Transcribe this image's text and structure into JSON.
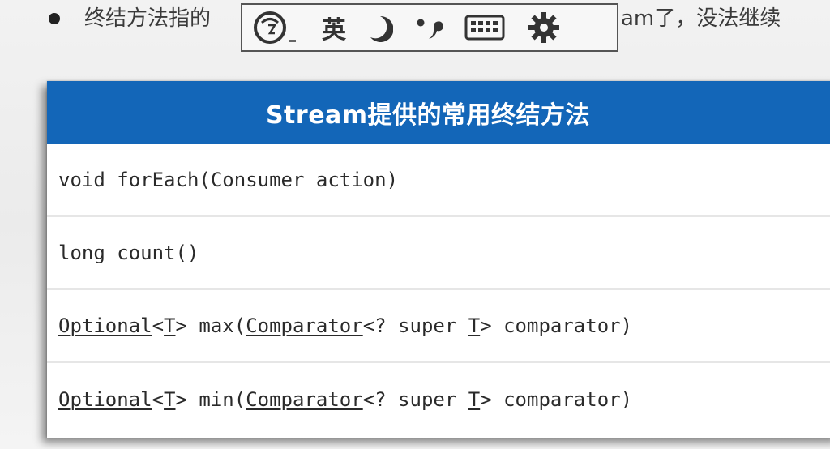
{
  "bullet": {
    "text_left": "终结方法指的",
    "text_right": "am了，没法继续"
  },
  "ime_toolbar": {
    "language_label": "英",
    "icons": [
      "ime-logo-icon",
      "moon-icon",
      "punctuation-icon",
      "keyboard-icon",
      "gear-icon"
    ]
  },
  "table": {
    "title": "Stream提供的常用终结方法",
    "rows": [
      {
        "parts": [
          {
            "text": "void forEach(Consumer action)",
            "underline": false
          }
        ]
      },
      {
        "parts": [
          {
            "text": "long count()",
            "underline": false
          }
        ]
      },
      {
        "parts": [
          {
            "text": "Optional",
            "underline": true
          },
          {
            "text": "<",
            "underline": false
          },
          {
            "text": "T",
            "underline": true
          },
          {
            "text": "> max(",
            "underline": false
          },
          {
            "text": "Comparator",
            "underline": true
          },
          {
            "text": "<? super ",
            "underline": false
          },
          {
            "text": "T",
            "underline": true
          },
          {
            "text": "> comparator)",
            "underline": false
          }
        ]
      },
      {
        "parts": [
          {
            "text": "Optional",
            "underline": true
          },
          {
            "text": "<",
            "underline": false
          },
          {
            "text": "T",
            "underline": true
          },
          {
            "text": "> min(",
            "underline": false
          },
          {
            "text": "Comparator",
            "underline": true
          },
          {
            "text": "<? super ",
            "underline": false
          },
          {
            "text": "T",
            "underline": true
          },
          {
            "text": "> comparator)",
            "underline": false
          }
        ]
      }
    ]
  },
  "colors": {
    "header_bg": "#1366b8",
    "header_text": "#ffffff",
    "row_divider": "#e6e6e6"
  }
}
